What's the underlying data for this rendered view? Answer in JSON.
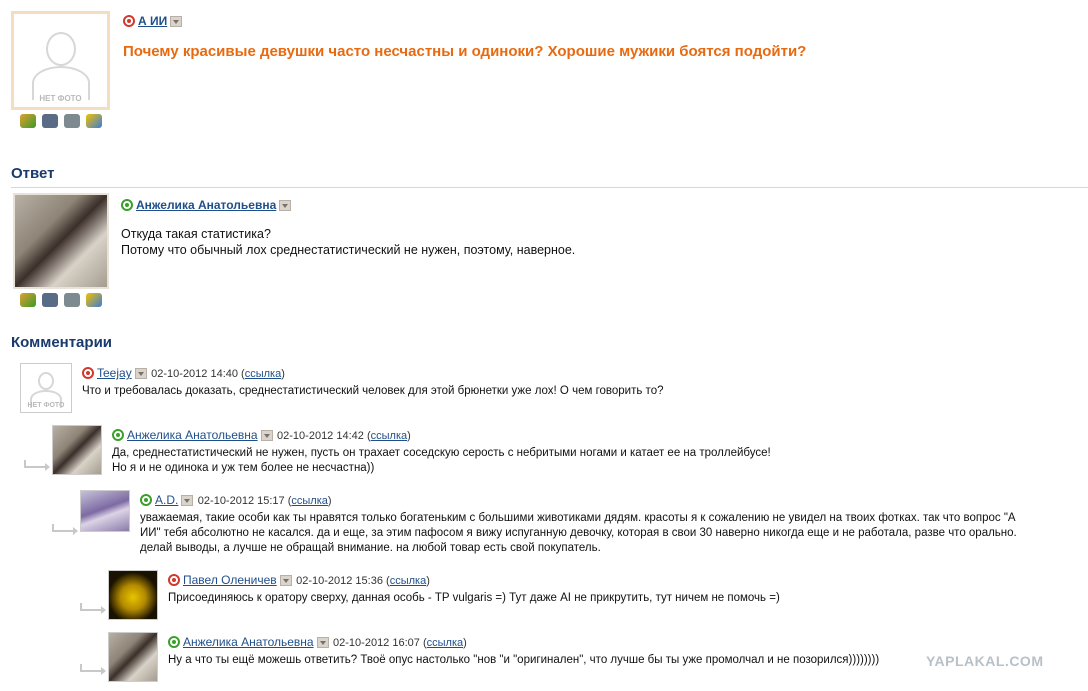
{
  "question": {
    "author": "А ИИ",
    "title": "Почему красивые девушки часто несчастны и одиноки? Хорошие мужики боятся подойти?",
    "avatar_label": "НЕТ ФОТО"
  },
  "answer_section": {
    "heading": "Ответ",
    "author": "Анжелика Анатольевна",
    "lines": [
      "Откуда такая статистика?",
      "Потому что обычный лох среднестатистический не нужен, поэтому, наверное."
    ]
  },
  "comments_section": {
    "heading": "Комментарии",
    "comments": [
      {
        "author": "Teejay",
        "date": "02-10-2012 14:40",
        "link": "ссылка",
        "avatar_label": "НЕТ ФОТО",
        "lines": [
          "Что и требовалась доказать, среднестатистический человек для этой брюнетки уже лох! О чем говорить то?"
        ]
      },
      {
        "author": "Анжелика Анатольевна",
        "date": "02-10-2012 14:42",
        "link": "ссылка",
        "lines": [
          "Да, среднестатистический не нужен, пусть он трахает соседскую серость с небритыми ногами и катает ее на троллейбусе!",
          "Но я и не одинока и уж тем более не несчастна))"
        ]
      },
      {
        "author": "A.D.",
        "date": "02-10-2012 15:17",
        "link": "ссылка",
        "lines": [
          "уважаемая, такие особи как ты нравятся только богатеньким с большими животиками дядям. красоты я к сожалению не увидел на твоих фотках. так что вопрос \"А",
          "ИИ\" тебя абсолютно не касался. да и еще, за этим пафосом я вижу испуганную девочку, которая в свои 30 наверно никогда еще и не работала, разве что орально.",
          "делай выводы, а лучше не обращай внимание. на любой товар есть свой покупатель."
        ]
      },
      {
        "author": "Павел Оленичев",
        "date": "02-10-2012 15:36",
        "link": "ссылка",
        "lines": [
          "Присоединяюсь к оратору сверху, данная особь - TP vulgaris =) Тут даже AI не прикрутить, тут ничем не помочь =)"
        ]
      },
      {
        "author": "Анжелика Анатольевна",
        "date": "02-10-2012 16:07",
        "link": "ссылка",
        "lines": [
          "Ну а что ты ещё можешь ответить? Твоё опус настолько \"нов \"и \"оригинален\", что лучше бы ты уже промолчал и не позорился))))))))"
        ]
      }
    ]
  },
  "watermark": "YAPLAKAL.COM",
  "colors": {
    "title_orange": "#e86a10",
    "link_blue": "#1f4f8a",
    "heading_blue": "#1a3a6e"
  }
}
